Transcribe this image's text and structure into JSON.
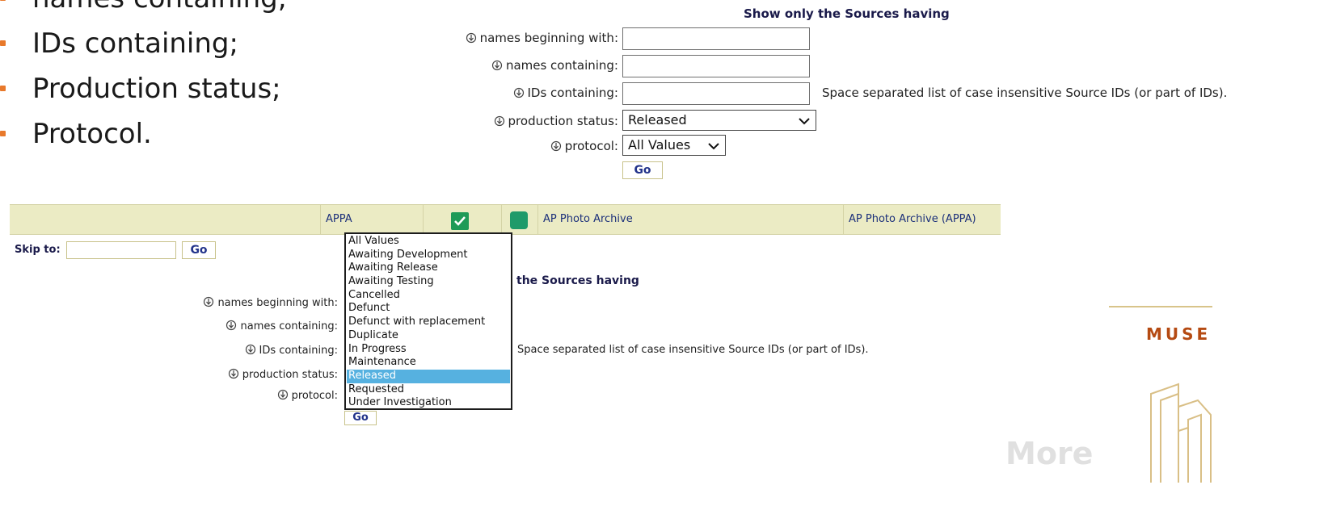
{
  "bullets": [
    "names containing;",
    "IDs containing;",
    "Production status;",
    "Protocol."
  ],
  "top_form": {
    "header": "Show only the Sources having",
    "labels": {
      "names_beginning": "names beginning with:",
      "names_containing": "names containing:",
      "ids_containing": "IDs containing:",
      "production_status": "production status:",
      "protocol": "protocol:"
    },
    "ids_note": "Space separated list of case insensitive Source IDs (or part of IDs).",
    "production_status_value": "Released",
    "protocol_value": "All Values",
    "go_label": "Go"
  },
  "table_row": {
    "code": "APPA",
    "name": "AP Photo Archive",
    "full_name": "AP Photo Archive (APPA)"
  },
  "bottom_form": {
    "skip_label": "Skip to:",
    "skip_go": "Go",
    "header_partial": "the Sources having",
    "labels": {
      "names_beginning": "names beginning with:",
      "names_containing": "names containing:",
      "ids_containing": "IDs containing:",
      "production_status": "production status:",
      "protocol": "protocol:"
    },
    "ids_note": "Space separated list of case insensitive Source IDs (or part of IDs).",
    "go_label": "Go"
  },
  "dropdown_options": [
    "All Values",
    "Awaiting Development",
    "Awaiting Release",
    "Awaiting Testing",
    "Cancelled",
    "Defunct",
    "Defunct with replacement",
    "Duplicate",
    "In Progress",
    "Maintenance",
    "Released",
    "Requested",
    "Under Investigation"
  ],
  "dropdown_selected": "Released",
  "side": {
    "muse": "MUSE",
    "more": "More"
  },
  "colors": {
    "accent_orange": "#e8792b",
    "row_bg": "#ebebc4",
    "link_blue": "#1b2f7a",
    "selected_bg": "#56b1e0",
    "check_green": "#1f9a57"
  },
  "icons": [
    "info-icon",
    "chevron-down-icon",
    "checkbox-checked-icon",
    "status-square-icon",
    "building-logo-icon"
  ]
}
